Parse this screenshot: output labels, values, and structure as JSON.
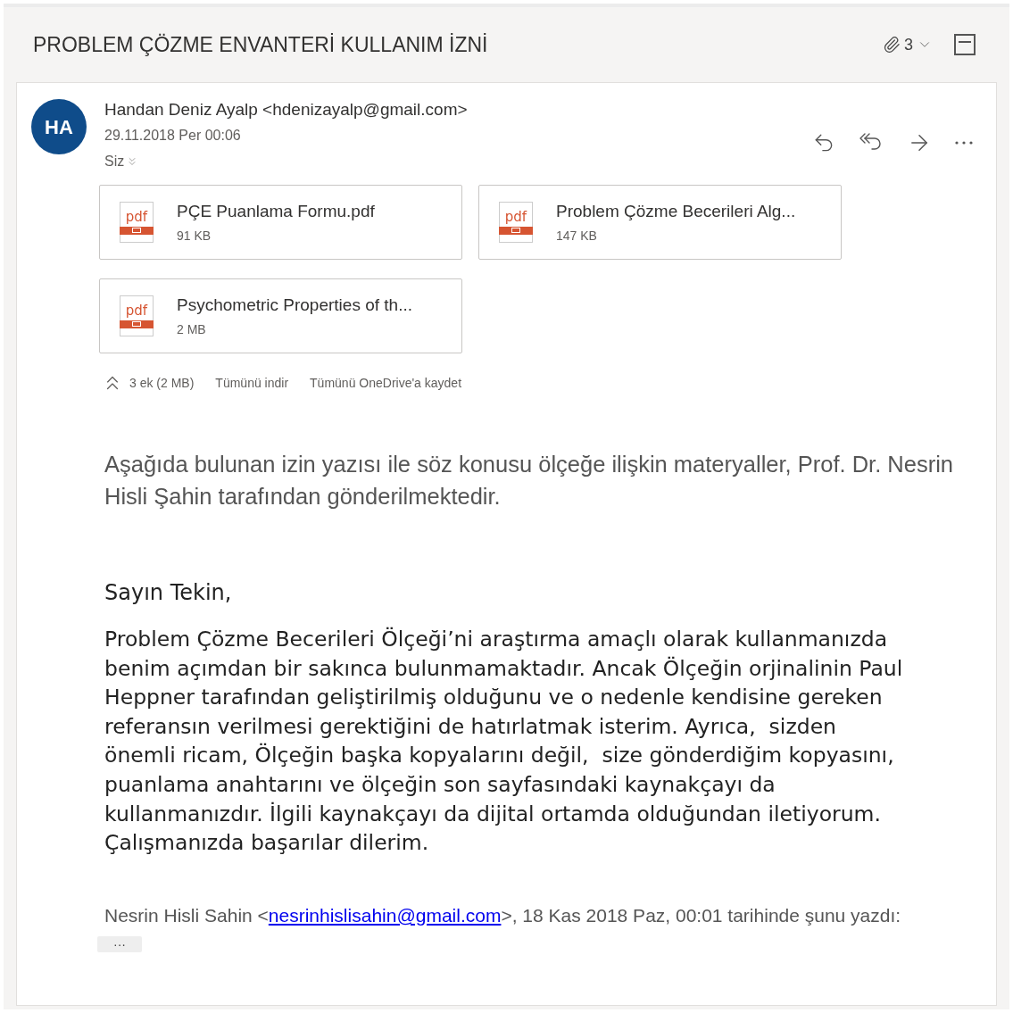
{
  "subject": "PROBLEM ÇÖZME ENVANTERİ KULLANIM İZNİ",
  "attachment_count": "3",
  "message": {
    "avatar": "HA",
    "sender": "Handan Deniz Ayalp <hdenizayalp@gmail.com>",
    "date": "29.11.2018 Per 00:06",
    "to": "Siz",
    "attachments": [
      {
        "name": "PÇE Puanlama Formu.pdf",
        "size": "91 KB",
        "icon_text": "pdf"
      },
      {
        "name": "Problem Çözme Becerileri Alg...",
        "size": "147 KB",
        "icon_text": "pdf"
      },
      {
        "name": "Psychometric Properties of th...",
        "size": "2 MB",
        "icon_text": "pdf"
      }
    ],
    "attachment_summary": "3 ek (2 MB)",
    "download_all": "Tümünü indir",
    "save_onedrive": "Tümünü OneDrive'a kaydet",
    "intro": "Aşağıda bulunan izin yazısı ile söz konusu ölçeğe ilişkin materyaller, Prof. Dr. Nesrin Hisli Şahin tarafından gönderilmektedir.",
    "greeting": "Sayın Tekin,",
    "letter_lines": [
      "Problem Çözme Becerileri Ölçeği’ni araştırma amaçlı olarak kullanmanızda",
      "benim açımdan bir sakınca bulunmamaktadır. Ancak Ölçeğin orjinalinin Paul",
      "Heppner tarafından geliştirilmiş olduğunu ve o nedenle kendisine gereken",
      "referansın verilmesi gerektiğini de hatırlatmak isterim. Ayrıca,  sizden",
      "önemli ricam, Ölçeğin başka kopyalarını değil,  size gönderdiğim kopyasını,",
      "puanlama anahtarını ve ölçeğin son sayfasındaki kaynakçayı da",
      "kullanmanızdır. İlgili kaynakçayı da dijital ortamda olduğundan iletiyorum.",
      "Çalışmanızda başarılar dilerim."
    ],
    "quote_prefix": "Nesrin Hisli Sahin <",
    "quote_link": "nesrinhislisahin@gmail.com",
    "quote_suffix": ">, 18 Kas 2018 Paz, 00:01 tarihinde şunu yazdı:",
    "expand_button": "···"
  }
}
